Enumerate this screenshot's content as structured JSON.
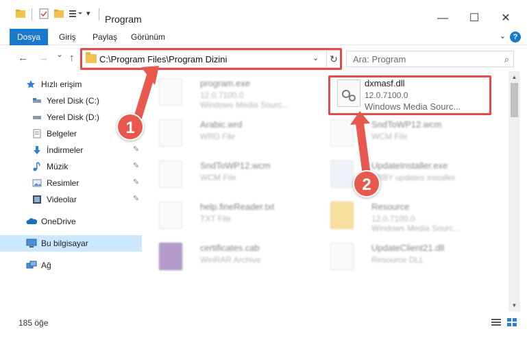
{
  "window": {
    "title": "Program",
    "minimize": "—",
    "maximize": "☐",
    "close": "✕"
  },
  "ribbon": {
    "tabs": [
      "Dosya",
      "Giriş",
      "Paylaş",
      "Görünüm"
    ],
    "help": "?"
  },
  "nav": {
    "back": "←",
    "forward": "→",
    "recent": "⌄",
    "up": "↑",
    "address": "C:\\Program Files\\Program Dizini",
    "address_dropdown": "⌄",
    "refresh": "↻",
    "search_placeholder": "Ara: Program",
    "search_icon": "⌕"
  },
  "sidebar": {
    "items": [
      {
        "label": "Hızlı erişim",
        "icon": "star-icon"
      },
      {
        "label": "Yerel Disk (C:)",
        "icon": "drive-icon"
      },
      {
        "label": "Yerel Disk (D:)",
        "icon": "drive-icon"
      },
      {
        "label": "Belgeler",
        "icon": "documents-icon"
      },
      {
        "label": "İndirmeler",
        "icon": "download-icon"
      },
      {
        "label": "Müzik",
        "icon": "music-icon"
      },
      {
        "label": "Resimler",
        "icon": "pictures-icon"
      },
      {
        "label": "Videolar",
        "icon": "videos-icon"
      },
      {
        "label": "OneDrive",
        "icon": "cloud-icon"
      },
      {
        "label": "Bu bilgisayar",
        "icon": "computer-icon"
      },
      {
        "label": "Ağ",
        "icon": "network-icon"
      }
    ],
    "pin": "📌"
  },
  "files": [
    {
      "name": "program.exe",
      "type": "12.0.7100.0",
      "desc": "Windows Media Sourc..."
    },
    {
      "name": "dxmasf.dll",
      "type": "12.0.7100.0",
      "desc": "Windows Media Sourc..."
    },
    {
      "name": "Arabic.wrd",
      "type": "WRD File",
      "desc": ""
    },
    {
      "name": "SndToWP12.wcm",
      "type": "WCM File",
      "desc": ""
    },
    {
      "name": "SndToWP12.wcm",
      "type": "WCM File",
      "desc": ""
    },
    {
      "name": "UpdateInstaller.exe",
      "type": "ABBY updates installer",
      "desc": ""
    },
    {
      "name": "help.fineReader.txt",
      "type": "TXT File",
      "desc": ""
    },
    {
      "name": "Resource",
      "type": "12.0.7100.0",
      "desc": "Windows Media Sourc..."
    },
    {
      "name": "certificates.cab",
      "type": "WinRAR Archive",
      "desc": ""
    },
    {
      "name": "UpdateClient21.dll",
      "type": "Resource DLL",
      "desc": ""
    }
  ],
  "status": {
    "count": "185 öğe"
  },
  "callouts": [
    "1",
    "2"
  ],
  "colors": {
    "accent": "#1979ca",
    "highlight": "#e14b4b",
    "selected": "#cce8ff",
    "folder": "#f3c44d"
  }
}
